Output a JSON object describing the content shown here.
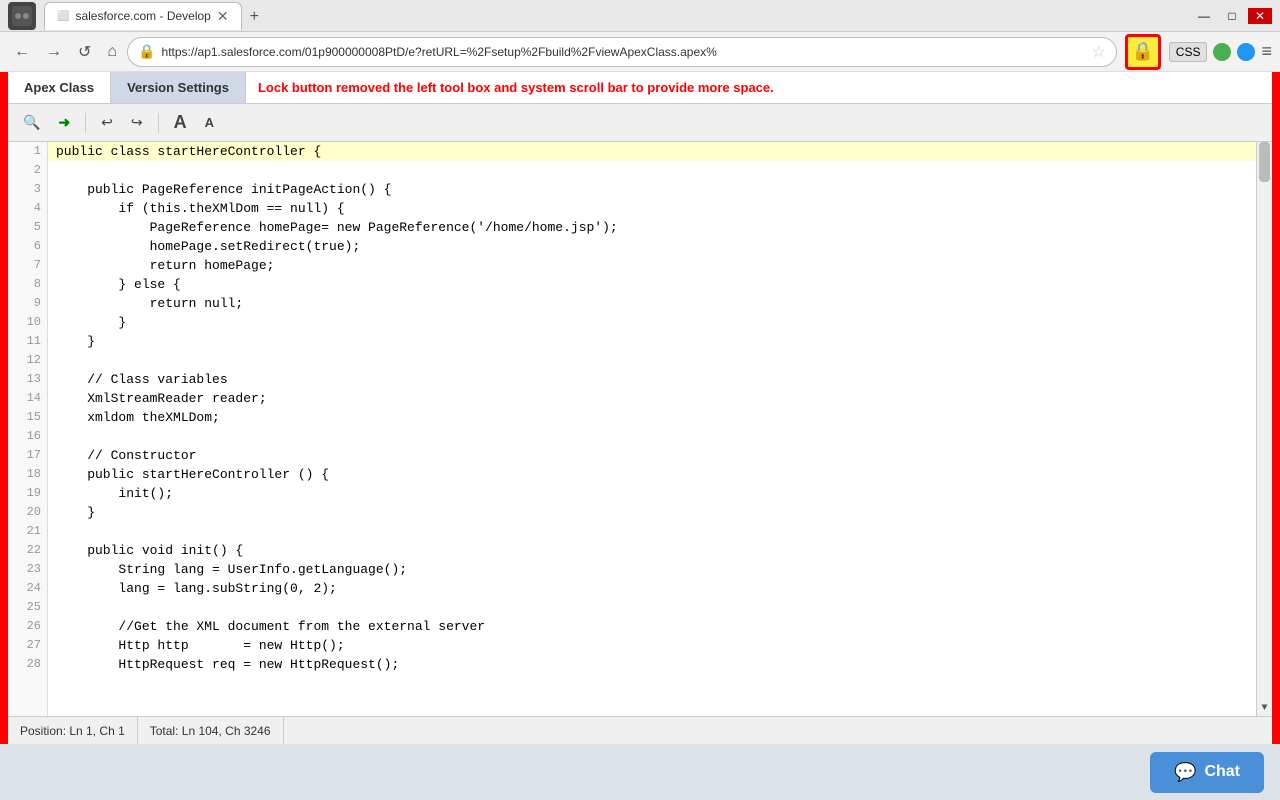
{
  "browser": {
    "tab_title": "salesforce.com - Develop",
    "url": "https://ap1.salesforce.com/01p900000008PtD/e?retURL=%2Fsetup%2Fbuild%2FviewApexClass.apex%",
    "nav_back": "←",
    "nav_forward": "→",
    "nav_refresh": "↺",
    "nav_home": "⌂",
    "css_label": "CSS",
    "menu_label": "≡"
  },
  "tabs": {
    "apex_class": "Apex Class",
    "version_settings": "Version Settings"
  },
  "info_banner": "Lock button removed the left tool box and system scroll bar to provide more space.",
  "toolbar": {
    "search": "🔍",
    "next": "→",
    "undo": "↩",
    "redo": "↪",
    "font_large": "A",
    "font_small": "A"
  },
  "code": {
    "lines": [
      {
        "num": 1,
        "text": "public class startHereController {",
        "highlight": true
      },
      {
        "num": 2,
        "text": "",
        "highlight": false
      },
      {
        "num": 3,
        "text": "    public PageReference initPageAction() {",
        "highlight": false
      },
      {
        "num": 4,
        "text": "        if (this.theXMlDom == null) {",
        "highlight": false
      },
      {
        "num": 5,
        "text": "            PageReference homePage= new PageReference('/home/home.jsp');",
        "highlight": false
      },
      {
        "num": 6,
        "text": "            homePage.setRedirect(true);",
        "highlight": false
      },
      {
        "num": 7,
        "text": "            return homePage;",
        "highlight": false
      },
      {
        "num": 8,
        "text": "        } else {",
        "highlight": false
      },
      {
        "num": 9,
        "text": "            return null;",
        "highlight": false
      },
      {
        "num": 10,
        "text": "        }",
        "highlight": false
      },
      {
        "num": 11,
        "text": "    }",
        "highlight": false
      },
      {
        "num": 12,
        "text": "",
        "highlight": false
      },
      {
        "num": 13,
        "text": "    // Class variables",
        "highlight": false
      },
      {
        "num": 14,
        "text": "    XmlStreamReader reader;",
        "highlight": false
      },
      {
        "num": 15,
        "text": "    xmldom theXMLDom;",
        "highlight": false
      },
      {
        "num": 16,
        "text": "",
        "highlight": false
      },
      {
        "num": 17,
        "text": "    // Constructor",
        "highlight": false
      },
      {
        "num": 18,
        "text": "    public startHereController () {",
        "highlight": false
      },
      {
        "num": 19,
        "text": "        init();",
        "highlight": false
      },
      {
        "num": 20,
        "text": "    }",
        "highlight": false
      },
      {
        "num": 21,
        "text": "",
        "highlight": false
      },
      {
        "num": 22,
        "text": "    public void init() {",
        "highlight": false
      },
      {
        "num": 23,
        "text": "        String lang = UserInfo.getLanguage();",
        "highlight": false
      },
      {
        "num": 24,
        "text": "        lang = lang.subString(0, 2);",
        "highlight": false
      },
      {
        "num": 25,
        "text": "",
        "highlight": false
      },
      {
        "num": 26,
        "text": "        //Get the XML document from the external server",
        "highlight": false
      },
      {
        "num": 27,
        "text": "        Http http       = new Http();",
        "highlight": false
      },
      {
        "num": 28,
        "text": "        HttpRequest req = new HttpRequest();",
        "highlight": false
      }
    ]
  },
  "status": {
    "position_label": "Position:",
    "position_value": "Ln 1, Ch 1",
    "total_label": "Total:",
    "total_value": "Ln 104, Ch 3246"
  },
  "chat": {
    "label": "Chat"
  }
}
